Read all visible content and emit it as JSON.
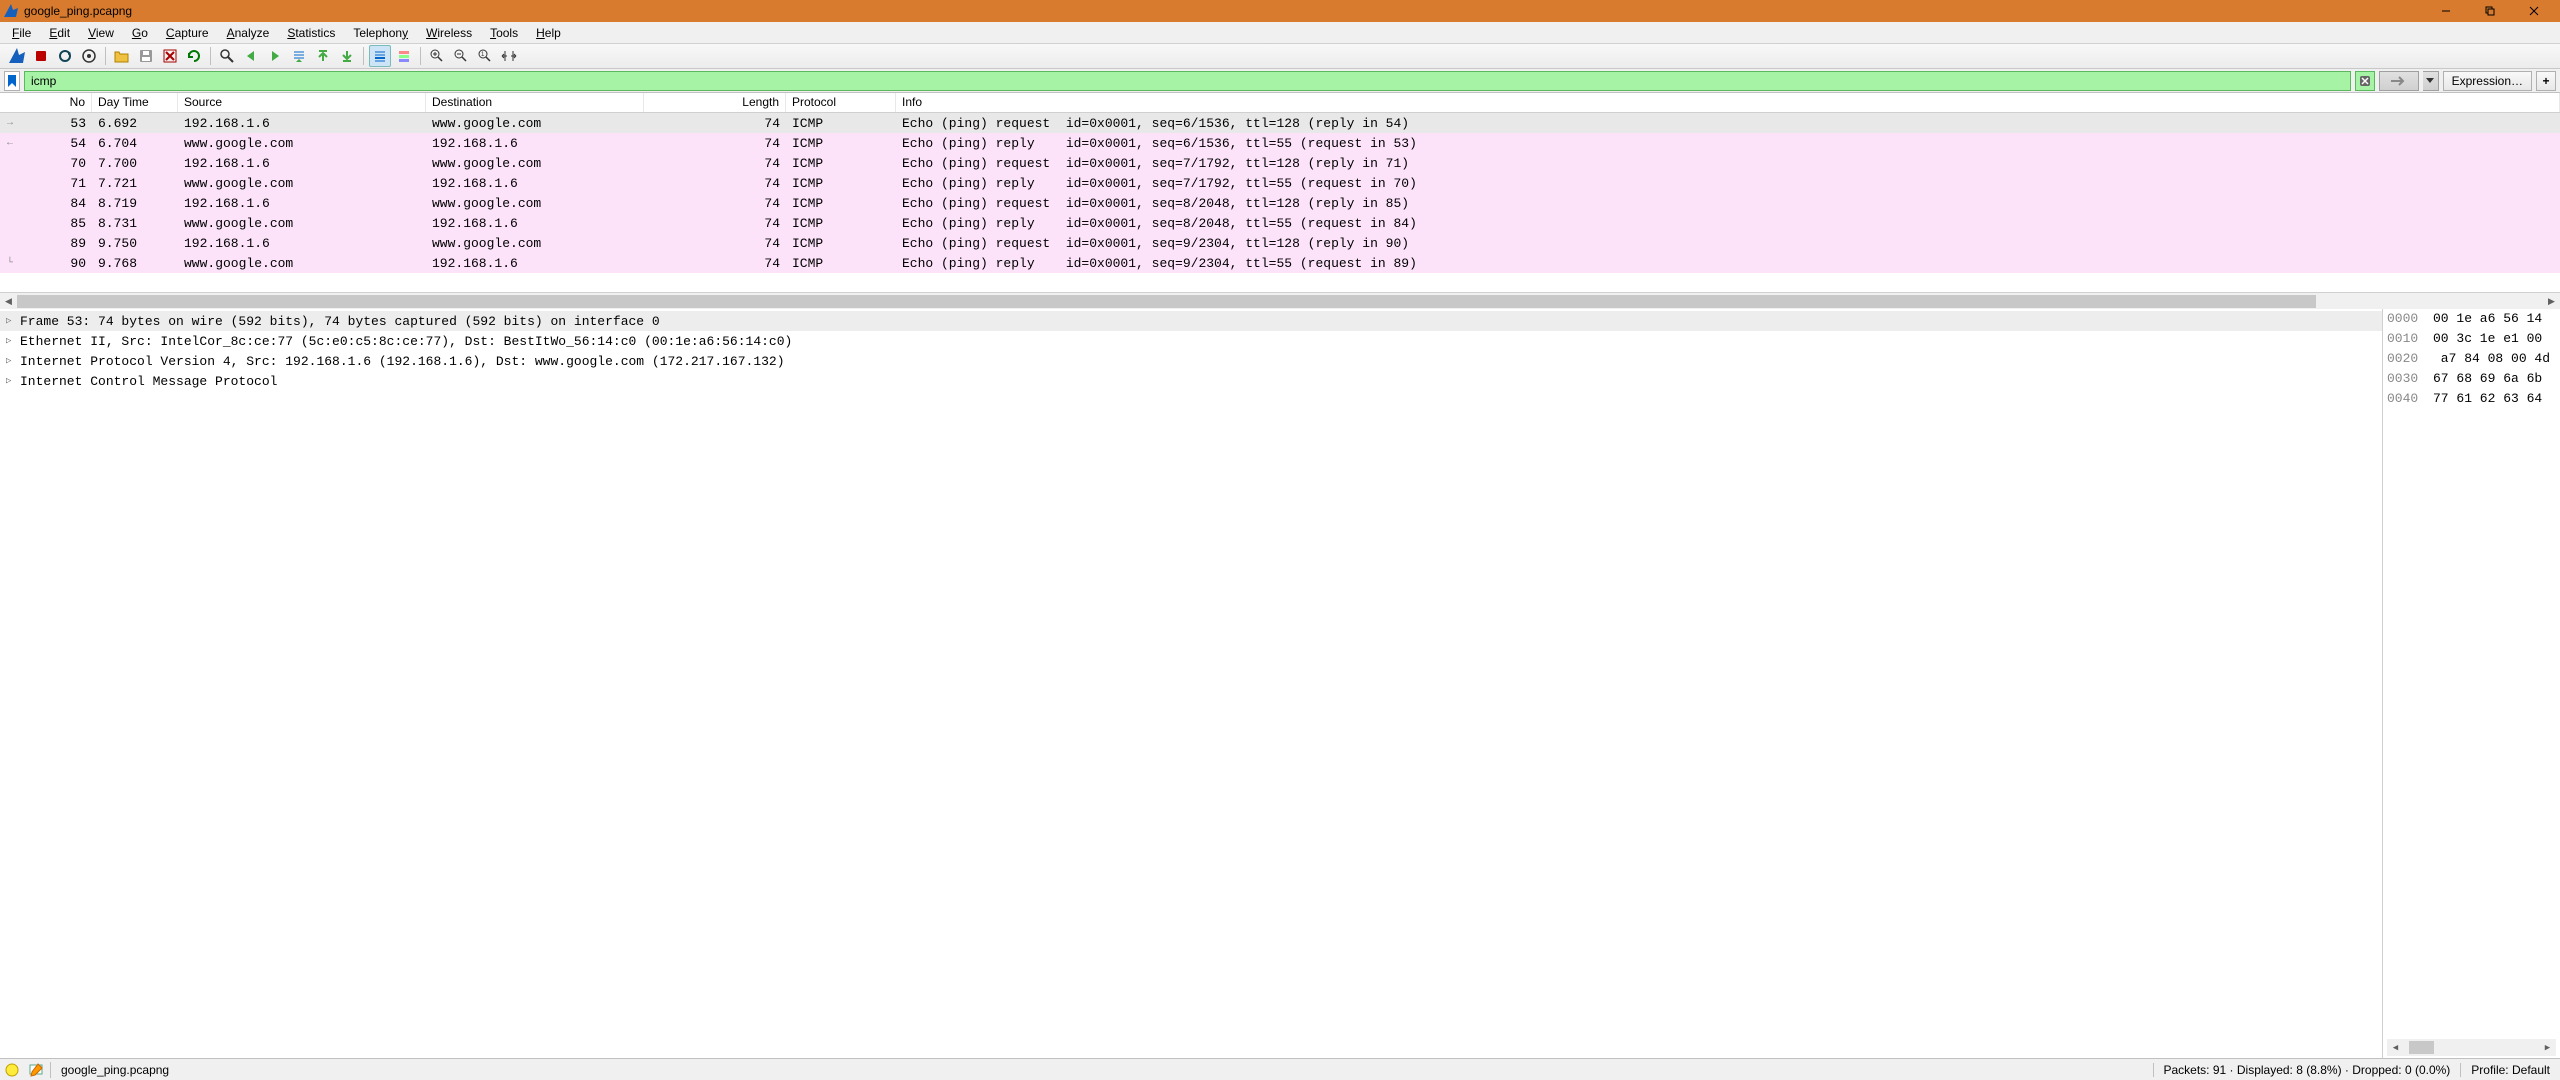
{
  "window": {
    "title": "google_ping.pcapng"
  },
  "menu": {
    "file": "File",
    "edit": "Edit",
    "view": "View",
    "go": "Go",
    "capture": "Capture",
    "analyze": "Analyze",
    "statistics": "Statistics",
    "telephony": "Telephony",
    "wireless": "Wireless",
    "tools": "Tools",
    "help": "Help"
  },
  "filter": {
    "value": "icmp",
    "expression_label": "Expression…",
    "add_label": "+"
  },
  "columns": {
    "no": "No",
    "time": "Day Time",
    "src": "Source",
    "dst": "Destination",
    "len": "Length",
    "proto": "Protocol",
    "info": "Info"
  },
  "packets": [
    {
      "no": "53",
      "time": "6.692",
      "src": "192.168.1.6",
      "dst": "www.google.com",
      "len": "74",
      "proto": "ICMP",
      "info": "Echo (ping) request  id=0x0001, seq=6/1536, ttl=128 (reply in 54)",
      "sel": true,
      "arrow": "req"
    },
    {
      "no": "54",
      "time": "6.704",
      "src": "www.google.com",
      "dst": "192.168.1.6",
      "len": "74",
      "proto": "ICMP",
      "info": "Echo (ping) reply    id=0x0001, seq=6/1536, ttl=55 (request in 53)",
      "arrow": "rep"
    },
    {
      "no": "70",
      "time": "7.700",
      "src": "192.168.1.6",
      "dst": "www.google.com",
      "len": "74",
      "proto": "ICMP",
      "info": "Echo (ping) request  id=0x0001, seq=7/1792, ttl=128 (reply in 71)"
    },
    {
      "no": "71",
      "time": "7.721",
      "src": "www.google.com",
      "dst": "192.168.1.6",
      "len": "74",
      "proto": "ICMP",
      "info": "Echo (ping) reply    id=0x0001, seq=7/1792, ttl=55 (request in 70)"
    },
    {
      "no": "84",
      "time": "8.719",
      "src": "192.168.1.6",
      "dst": "www.google.com",
      "len": "74",
      "proto": "ICMP",
      "info": "Echo (ping) request  id=0x0001, seq=8/2048, ttl=128 (reply in 85)"
    },
    {
      "no": "85",
      "time": "8.731",
      "src": "www.google.com",
      "dst": "192.168.1.6",
      "len": "74",
      "proto": "ICMP",
      "info": "Echo (ping) reply    id=0x0001, seq=8/2048, ttl=55 (request in 84)"
    },
    {
      "no": "89",
      "time": "9.750",
      "src": "192.168.1.6",
      "dst": "www.google.com",
      "len": "74",
      "proto": "ICMP",
      "info": "Echo (ping) request  id=0x0001, seq=9/2304, ttl=128 (reply in 90)"
    },
    {
      "no": "90",
      "time": "9.768",
      "src": "www.google.com",
      "dst": "192.168.1.6",
      "len": "74",
      "proto": "ICMP",
      "info": "Echo (ping) reply    id=0x0001, seq=9/2304, ttl=55 (request in 89)",
      "arrow": "last"
    }
  ],
  "details": [
    {
      "text": "Frame 53: 74 bytes on wire (592 bits), 74 bytes captured (592 bits) on interface 0",
      "hl": true
    },
    {
      "text": "Ethernet II, Src: IntelCor_8c:ce:77 (5c:e0:c5:8c:ce:77), Dst: BestItWo_56:14:c0 (00:1e:a6:56:14:c0)"
    },
    {
      "text": "Internet Protocol Version 4, Src: 192.168.1.6 (192.168.1.6), Dst: www.google.com (172.217.167.132)"
    },
    {
      "text": "Internet Control Message Protocol"
    }
  ],
  "hex": [
    {
      "off": "0000",
      "bytes": "00 1e a6 56 14"
    },
    {
      "off": "0010",
      "bytes": "00 3c 1e e1 00"
    },
    {
      "off": "0020",
      "bytes": " a7 84 08 00 4d"
    },
    {
      "off": "0030",
      "bytes": "67 68 69 6a 6b"
    },
    {
      "off": "0040",
      "bytes": "77 61 62 63 64"
    }
  ],
  "status": {
    "file": "google_ping.pcapng",
    "stats": "Packets: 91 · Displayed: 8 (8.8%) · Dropped: 0 (0.0%)",
    "profile": "Profile: Default"
  }
}
